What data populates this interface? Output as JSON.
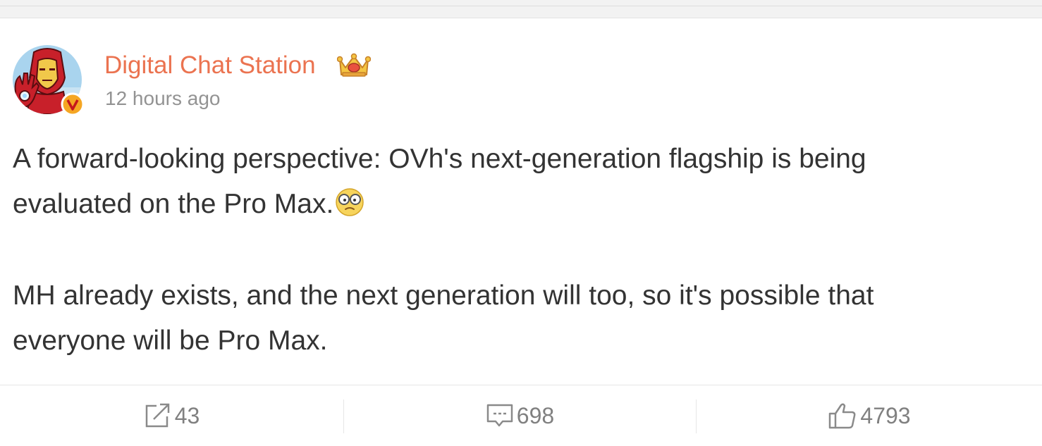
{
  "post": {
    "author": {
      "name": "Digital Chat Station",
      "avatar_icon": "iron-man-avatar",
      "verified_icon": "verified-v-badge",
      "member_icon": "crown-icon"
    },
    "timestamp": "12 hours ago",
    "paragraphs": [
      {
        "line1": "A forward-looking perspective: OVh's next-generation flagship is being",
        "line2": "evaluated on the Pro Max.",
        "emoji": "glasses-emoji"
      },
      {
        "line1": "MH already exists, and the next generation will too, so it's possible that",
        "line2": "everyone will be Pro Max."
      }
    ],
    "actions": {
      "repost_count": "43",
      "comment_count": "698",
      "like_count": "4793"
    }
  },
  "colors": {
    "author_name": "#eb7350",
    "timestamp": "#939393",
    "body_text": "#333333",
    "action_text": "#808080",
    "badge": "#f5a623"
  }
}
